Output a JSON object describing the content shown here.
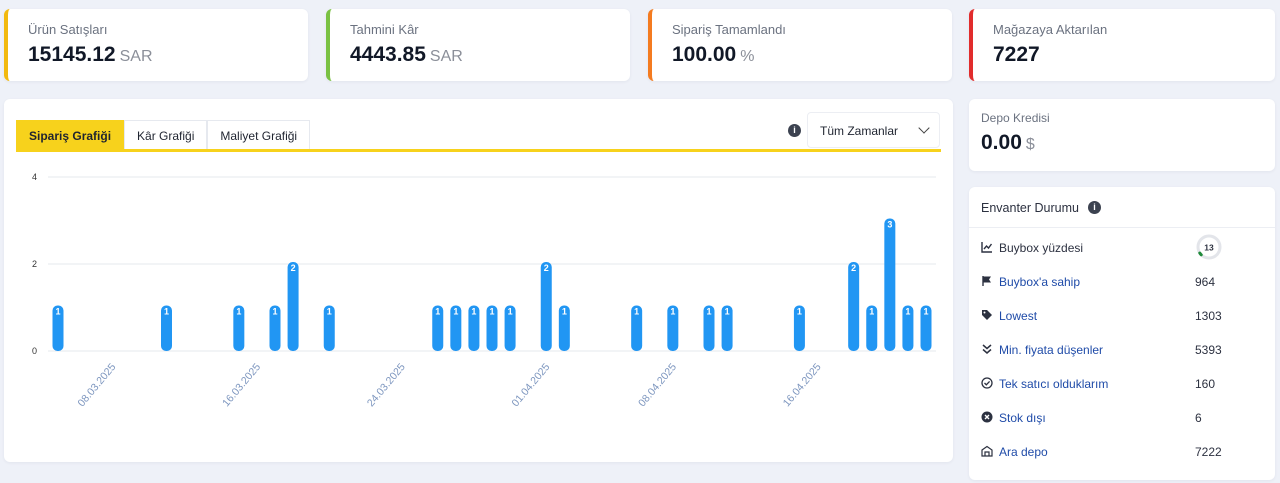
{
  "stats": [
    {
      "label": "Ürün Satışları",
      "value": "15145.12",
      "unit": "SAR",
      "color": "#f2b90f"
    },
    {
      "label": "Tahmini Kâr",
      "value": "4443.85",
      "unit": "SAR",
      "color": "#7ac143"
    },
    {
      "label": "Sipariş Tamamlandı",
      "value": "100.00",
      "unit": "%",
      "color": "#f47b20"
    },
    {
      "label": "Mağazaya Aktarılan",
      "value": "7227",
      "unit": "",
      "color": "#e12c2c"
    }
  ],
  "chart_card": {
    "tabs": [
      "Sipariş Grafiği",
      "Kâr Grafiği",
      "Maliyet Grafiği"
    ],
    "active_tab": "Sipariş Grafiği",
    "info_icon": "info-icon",
    "range": "Tüm Zamanlar"
  },
  "chart_data": {
    "type": "bar",
    "bar_color": "#2196f3",
    "y_ticks": [
      0,
      2,
      4
    ],
    "ylim": [
      0,
      4
    ],
    "x_tick_labels": [
      "08.03.2025",
      "16.03.2025",
      "24.03.2025",
      "01.04.2025",
      "08.04.2025",
      "16.04.2025"
    ],
    "x_tick_positions": [
      2,
      10,
      18,
      26,
      33,
      41
    ],
    "x_range": [
      0,
      48
    ],
    "points": [
      {
        "x": 0,
        "y": 1
      },
      {
        "x": 6,
        "y": 1
      },
      {
        "x": 10,
        "y": 1
      },
      {
        "x": 12,
        "y": 1
      },
      {
        "x": 13,
        "y": 2
      },
      {
        "x": 15,
        "y": 1
      },
      {
        "x": 21,
        "y": 1
      },
      {
        "x": 22,
        "y": 1
      },
      {
        "x": 23,
        "y": 1
      },
      {
        "x": 24,
        "y": 1
      },
      {
        "x": 25,
        "y": 1
      },
      {
        "x": 27,
        "y": 2
      },
      {
        "x": 28,
        "y": 1
      },
      {
        "x": 32,
        "y": 1
      },
      {
        "x": 34,
        "y": 1
      },
      {
        "x": 36,
        "y": 1
      },
      {
        "x": 37,
        "y": 1
      },
      {
        "x": 41,
        "y": 1
      },
      {
        "x": 44,
        "y": 2
      },
      {
        "x": 45,
        "y": 1
      },
      {
        "x": 46,
        "y": 3
      },
      {
        "x": 47,
        "y": 1
      },
      {
        "x": 48,
        "y": 1
      }
    ]
  },
  "credit": {
    "label": "Depo Kredisi",
    "value": "0.00",
    "unit": "$"
  },
  "inventory": {
    "title": "Envanter Durumu",
    "buybox": {
      "label": "Buybox yüzdesi",
      "value": "13",
      "percent": 13
    },
    "rows": [
      {
        "icon": "flag-icon",
        "label": "Buybox'a sahip",
        "value": "964"
      },
      {
        "icon": "tag-icon",
        "label": "Lowest",
        "value": "1303"
      },
      {
        "icon": "double-chevron-down-icon",
        "label": "Min. fiyata düşenler",
        "value": "5393"
      },
      {
        "icon": "check-circle-icon",
        "label": "Tek satıcı olduklarım",
        "value": "160"
      },
      {
        "icon": "x-circle-icon",
        "label": "Stok dışı",
        "value": "6"
      },
      {
        "icon": "warehouse-icon",
        "label": "Ara depo",
        "value": "7222"
      }
    ]
  }
}
